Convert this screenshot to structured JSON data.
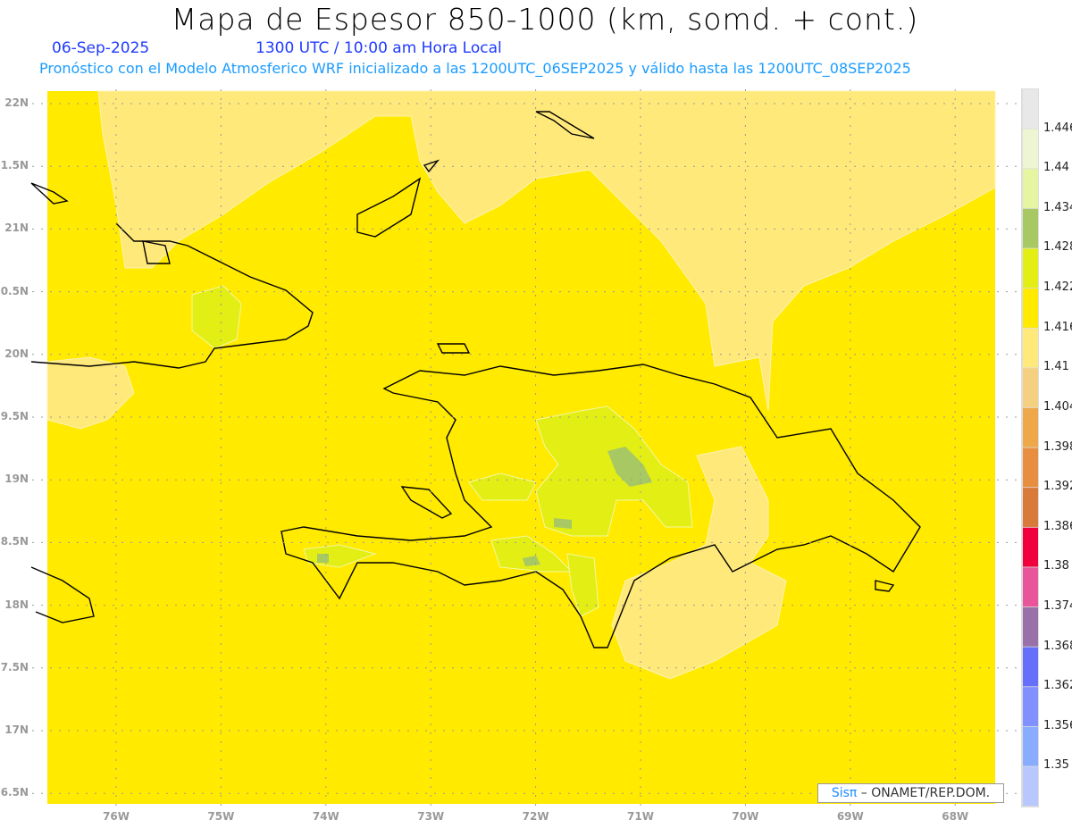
{
  "header": {
    "title": "Mapa de Espesor 850-1000 (km, somd. + cont.)",
    "date": "06-Sep-2025",
    "time": "1300 UTC / 10:00 am Hora Local",
    "description": "Pronóstico con el Modelo Atmosferico WRF inicializado a las 1200UTC_06SEP2025 y válido hasta las  1200UTC_08SEP2025"
  },
  "map": {
    "lat_labels": [
      "22N",
      "1.5N",
      "21N",
      "0.5N",
      "20N",
      "9.5N",
      "19N",
      "8.5N",
      "18N",
      "7.5N",
      "17N",
      "6.5N"
    ],
    "lon_labels": [
      "76W",
      "75W",
      "74W",
      "73W",
      "72W",
      "71W",
      "70W",
      "69W",
      "68W"
    ],
    "dominant_color": "#ffea00"
  },
  "colorbar": {
    "labels": [
      "1.446",
      "1.44",
      "1.434",
      "1.428",
      "1.422",
      "1.416",
      "1.41",
      "1.404",
      "1.398",
      "1.392",
      "1.386",
      "1.38",
      "1.374",
      "1.368",
      "1.362",
      "1.356",
      "1.35"
    ],
    "colors": [
      "#e8e8e8",
      "#eef5d2",
      "#e6f5a2",
      "#a8c864",
      "#e2ee14",
      "#ffea00",
      "#ffe97a",
      "#f5d080",
      "#eea84a",
      "#e88e40",
      "#d87a3a",
      "#f0003c",
      "#e8559a",
      "#9a70a8",
      "#6470fa",
      "#8090ff",
      "#8aacff",
      "#b8c8ff"
    ]
  },
  "credit": {
    "brand": "Sisπ",
    "text": " –  ONAMET/REP.DOM."
  }
}
